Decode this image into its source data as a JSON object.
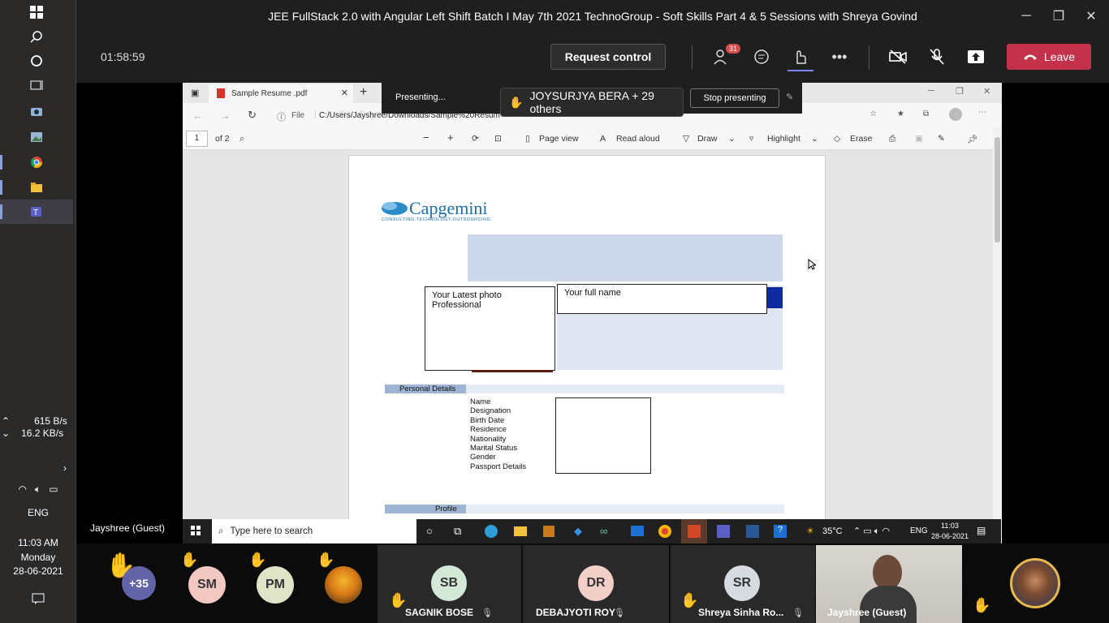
{
  "window": {
    "title": "JEE FullStack 2.0 with Angular Left Shift Batch I May 7th 2021 TechnoGroup - Soft Skills Part 4 & 5 Sessions with Shreya Govind"
  },
  "call": {
    "timer": "01:58:59",
    "request_control_label": "Request control",
    "participants_badge": "31",
    "leave_label": "Leave"
  },
  "presenting": {
    "status": "Presenting...",
    "raised_hands": "JOYSURJYA BERA + 29 others",
    "stop_label": "Stop presenting"
  },
  "browser": {
    "tab_title": "Sample Resume .pdf",
    "url_scheme": "File",
    "url": "C:/Users/Jayshree/Downloads/Sample%20Resum"
  },
  "pdf_toolbar": {
    "page_number": "1",
    "page_total": "of 2",
    "page_view": "Page view",
    "read_aloud": "Read aloud",
    "draw": "Draw",
    "highlight": "Highlight",
    "erase": "Erase"
  },
  "document": {
    "logo_name": "Capgemini",
    "logo_tagline": "CONSULTING.TECHNOLOGY.OUTSOURCING",
    "photo_placeholder": "Your Latest photo\nProfessional",
    "name_placeholder": "Your full name",
    "personal_details_heading": "Personal Details",
    "fields": [
      "Name",
      "Designation",
      "Birth Date",
      "Residence",
      "Nationality",
      "Marital Status",
      "Gender",
      "Passport Details"
    ],
    "profile_heading": "Profile"
  },
  "shared_taskbar": {
    "search_placeholder": "Type here to search",
    "weather": "35°C",
    "lang": "ENG",
    "time": "11:03",
    "date": "28-06-2021"
  },
  "presenter_label": "Jayshree (Guest)",
  "windows_taskbar": {
    "upload": "615 B/s",
    "download": "16.2 KB/s",
    "lang": "ENG",
    "time": "11:03 AM",
    "day": "Monday",
    "date": "28-06-2021"
  },
  "roster": {
    "overflow": "+35",
    "avatars": [
      {
        "initials": "SM",
        "color": "#f1c8c2"
      },
      {
        "initials": "PM",
        "color": "#dfe3c8"
      }
    ],
    "tiles": [
      {
        "initials": "SB",
        "name": "SAGNIK BOSE",
        "color": "#d3e8d6"
      },
      {
        "initials": "DR",
        "name": "DEBAJYOTI ROY",
        "color": "#f3cfc9"
      },
      {
        "initials": "SR",
        "name": "Shreya Sinha Ro...",
        "color": "#d5dbe0"
      }
    ],
    "video_name": "Jayshree (Guest)"
  },
  "colors": {
    "leave": "#c4314b",
    "accent": "#6264a7",
    "doc_band": "#cdd9ea",
    "doc_blue": "#0d2aa0"
  }
}
